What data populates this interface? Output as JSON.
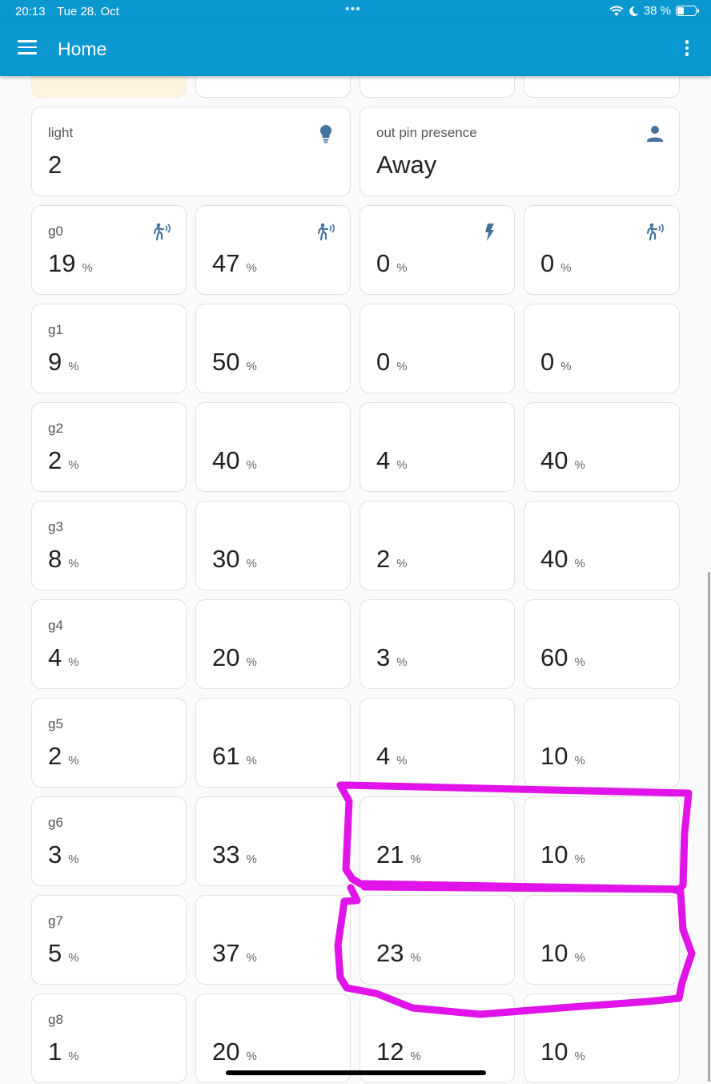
{
  "status": {
    "time": "20:13",
    "date": "Tue 28. Oct",
    "dots": "•••",
    "battery": "38 %",
    "battery_level": 0.38
  },
  "appbar": {
    "title": "Home"
  },
  "cards": {
    "light": {
      "label": "light",
      "value": "2",
      "icon": "lightbulb-icon"
    },
    "presence": {
      "label": "out pin presence",
      "value": "Away",
      "icon": "person-icon"
    }
  },
  "grid": {
    "unit": "%",
    "rows": [
      {
        "label": "g0",
        "values": [
          "19",
          "47",
          "0",
          "0"
        ],
        "icons": [
          "motion-sensor-icon",
          "motion-sensor-icon",
          "flash-icon",
          "motion-sensor-icon"
        ]
      },
      {
        "label": "g1",
        "values": [
          "9",
          "50",
          "0",
          "0"
        ]
      },
      {
        "label": "g2",
        "values": [
          "2",
          "40",
          "4",
          "40"
        ]
      },
      {
        "label": "g3",
        "values": [
          "8",
          "30",
          "2",
          "40"
        ]
      },
      {
        "label": "g4",
        "values": [
          "4",
          "20",
          "3",
          "60"
        ]
      },
      {
        "label": "g5",
        "values": [
          "2",
          "61",
          "4",
          "10"
        ]
      },
      {
        "label": "g6",
        "values": [
          "3",
          "33",
          "21",
          "10"
        ]
      },
      {
        "label": "g7",
        "values": [
          "5",
          "37",
          "23",
          "10"
        ]
      },
      {
        "label": "g8",
        "values": [
          "1",
          "20",
          "12",
          "10"
        ]
      }
    ]
  },
  "colors": {
    "appbar": "#0b98d0",
    "icon": "#44739e",
    "annotation": "#e014e8"
  }
}
